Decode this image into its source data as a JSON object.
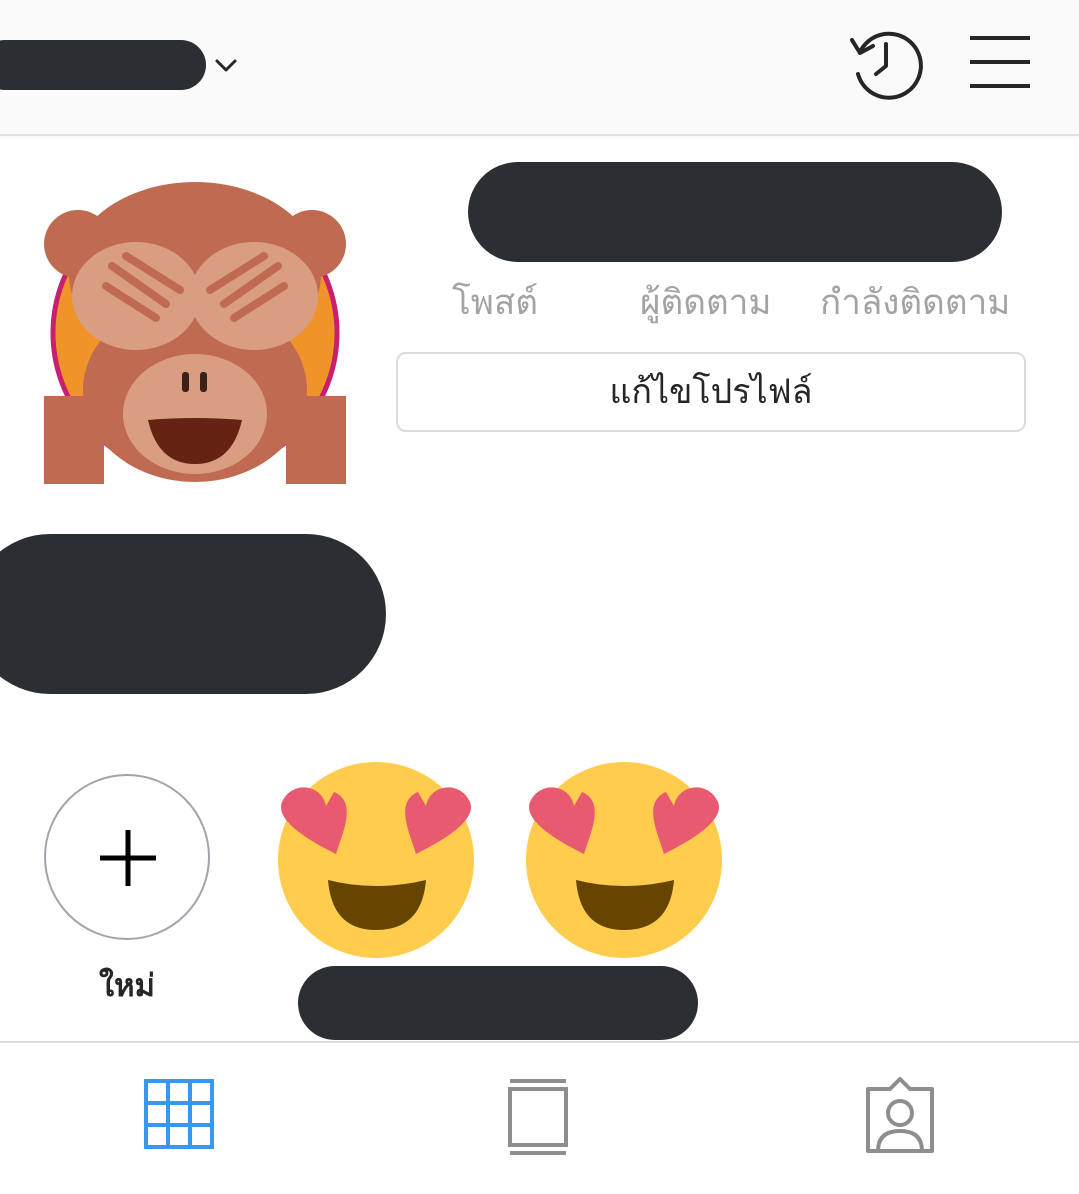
{
  "header": {
    "username": "",
    "icons": {
      "dropdown": "chevron-down-icon",
      "history": "history-icon",
      "menu": "hamburger-menu-icon"
    }
  },
  "profile": {
    "avatar_icon": "see-no-evil-monkey-emoji",
    "full_name": "",
    "stats": {
      "posts_label": "โพสต์",
      "followers_label": "ผู้ติดตาม",
      "following_label": "กำลังติดตาม"
    },
    "edit_profile_label": "แก้ไขโปรไฟล์",
    "bio": ""
  },
  "highlights": {
    "new_label": "ใหม่",
    "items": [
      {
        "icon": "heart-eyes-emoji",
        "label": ""
      },
      {
        "icon": "heart-eyes-emoji",
        "label": ""
      }
    ]
  },
  "tabs": [
    {
      "icon": "grid-icon",
      "active": true
    },
    {
      "icon": "feed-icon",
      "active": false
    },
    {
      "icon": "tagged-icon",
      "active": false
    }
  ],
  "colors": {
    "active_tab": "#3897f0",
    "inactive_tab": "#8e8e8e",
    "redaction": "#2b2f33",
    "label_gray": "#a3a3a3"
  }
}
